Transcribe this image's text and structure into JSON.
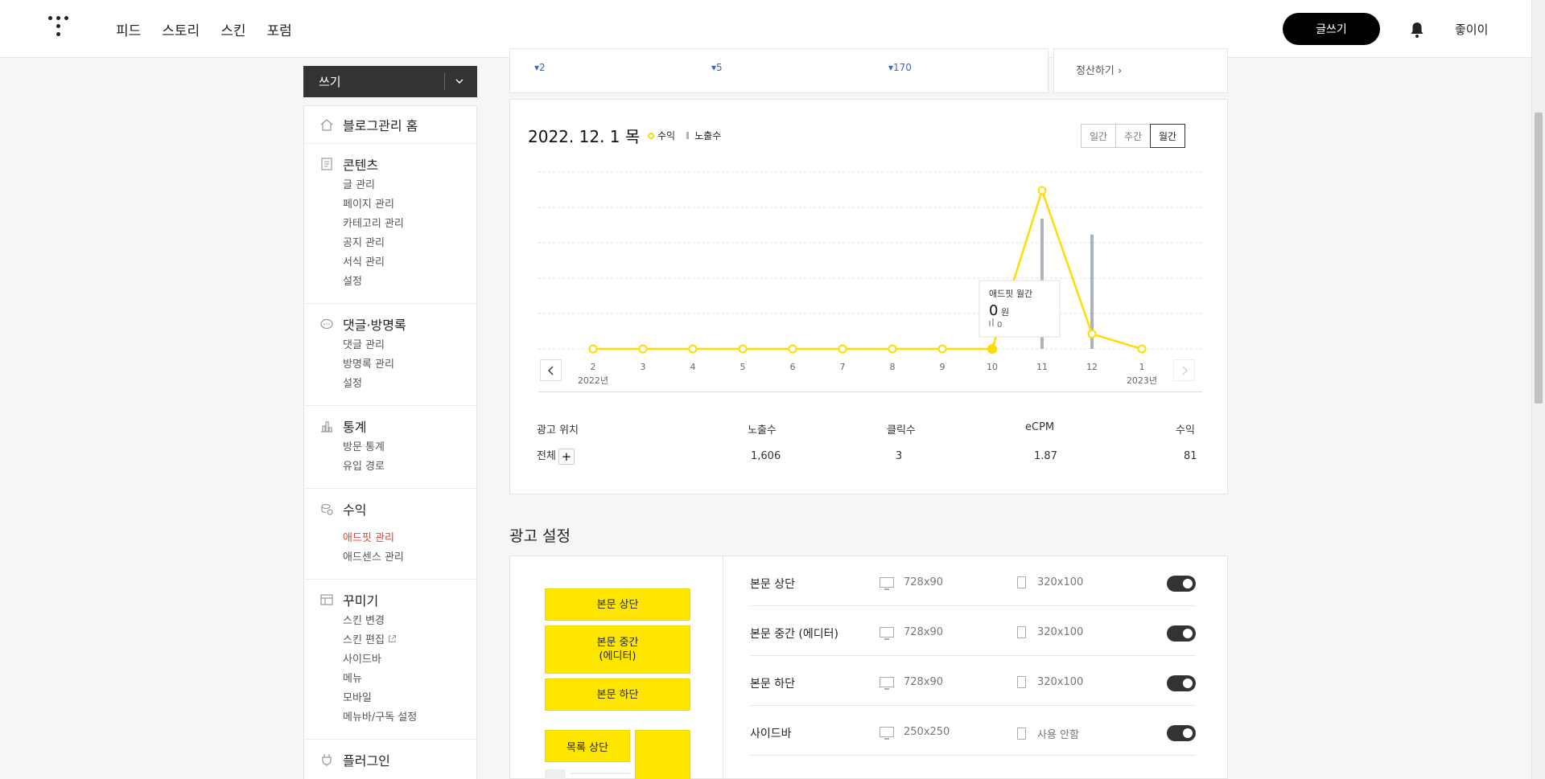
{
  "header": {
    "nav": [
      "피드",
      "스토리",
      "스킨",
      "포럼"
    ],
    "write_button": "글쓰기",
    "user_name": "좋이이"
  },
  "sidebar": {
    "write_label": "쓰기",
    "sections": [
      {
        "title": "블로그관리 홈",
        "icon": "home-icon",
        "items": []
      },
      {
        "title": "콘텐츠",
        "icon": "document-icon",
        "items": [
          "글 관리",
          "페이지 관리",
          "카테고리 관리",
          "공지 관리",
          "서식 관리",
          "설정"
        ]
      },
      {
        "title": "댓글·방명록",
        "icon": "speech-bubble-icon",
        "items": [
          "댓글 관리",
          "방명록 관리",
          "설정"
        ]
      },
      {
        "title": "통계",
        "icon": "bar-chart-icon",
        "items": [
          "방문 통계",
          "유입 경로"
        ]
      },
      {
        "title": "수익",
        "icon": "coins-icon",
        "items": [
          "애드핏 관리",
          "애드센스 관리"
        ]
      },
      {
        "title": "꾸미기",
        "icon": "layout-icon",
        "items": [
          "스킨 변경",
          "스킨 편집",
          "사이드바",
          "메뉴",
          "모바일",
          "메뉴바/구독 설정"
        ]
      },
      {
        "title": "플러그인",
        "icon": "plug-icon",
        "items": []
      }
    ],
    "active_item": "애드핏 관리"
  },
  "summary": {
    "deltas": [
      "2",
      "5",
      "170"
    ],
    "settle_label": "정산하기"
  },
  "chart_panel": {
    "date": "2022. 12. 1 목",
    "legend": [
      "수익",
      "노출수"
    ],
    "periods": [
      "일간",
      "주간",
      "월간"
    ],
    "active_period": "월간",
    "tooltip": {
      "title": "애드핏 월간",
      "value": "0",
      "unit": "원",
      "impressions": "0"
    },
    "year_start": "2022년",
    "year_end": "2023년"
  },
  "chart_data": {
    "type": "line",
    "categories": [
      "2",
      "3",
      "4",
      "5",
      "6",
      "7",
      "8",
      "9",
      "10",
      "11",
      "12",
      "1"
    ],
    "series": [
      {
        "name": "수익",
        "type": "line",
        "values": [
          0,
          0,
          0,
          0,
          0,
          0,
          0,
          0,
          0,
          74,
          7,
          0
        ]
      },
      {
        "name": "노출수",
        "type": "bar",
        "values": [
          0,
          0,
          0,
          0,
          0,
          0,
          0,
          0,
          0,
          1150,
          1010,
          0
        ]
      }
    ],
    "colors": {
      "line": "#ffdd00",
      "bar": "#aab4c0"
    },
    "grid": true,
    "selected_index": 8
  },
  "ad_table": {
    "headers": [
      "광고 위치",
      "노출수",
      "클릭수",
      "eCPM",
      "수익"
    ],
    "row": {
      "position": "전체",
      "impressions": "1,606",
      "clicks": "3",
      "ecpm": "1.87",
      "revenue": "81"
    }
  },
  "ad_settings": {
    "title": "광고 설정",
    "preview_blocks": [
      "본문 상단",
      "본문 중간\n(에디터)",
      "본문 하단",
      "목록 상단"
    ],
    "rows": [
      {
        "name": "본문 상단",
        "pc": "728x90",
        "mobile": "320x100",
        "enabled": true
      },
      {
        "name": "본문 중간 (에디터)",
        "pc": "728x90",
        "mobile": "320x100",
        "enabled": true
      },
      {
        "name": "본문 하단",
        "pc": "728x90",
        "mobile": "320x100",
        "enabled": true
      },
      {
        "name": "사이드바",
        "pc": "250x250",
        "mobile": "사용 안함",
        "enabled": true
      }
    ]
  }
}
